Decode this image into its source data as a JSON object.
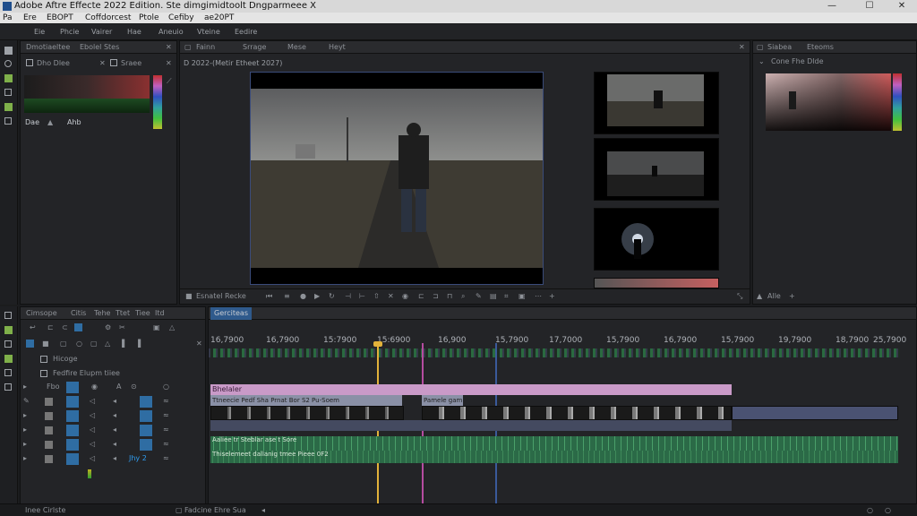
{
  "window": {
    "title": "Adobe Aftre Effecte 2022 Edition. Ste dimgimidtoolt Dngparmeee X",
    "minimize": "—",
    "maximize": "☐",
    "close": "✕"
  },
  "menubar": [
    "Pa",
    "Ere",
    "EBOPT",
    "Coffdorcest",
    "Ptole",
    "Cefiby",
    "ae20PT"
  ],
  "mainbar": {
    "items": [
      "Eie",
      "Phcie",
      "Vairer",
      "Hae",
      "Aneuio",
      "Vteine",
      "Eedire"
    ]
  },
  "left_panel": {
    "tabs": [
      "Dmotiaeltee",
      "Ebolel Stes"
    ],
    "sub_label": "Dho Dlee",
    "sub_label2": "Sraee",
    "footer": [
      "Dae",
      "Ahb"
    ]
  },
  "viewer_panel": {
    "tabs": [
      "Fainn",
      "Srrage",
      "Mese",
      "Heyt"
    ],
    "breadcrumb": "D 2022-(Metir Etheet 2027)",
    "footer_label": "Esnatel Recke"
  },
  "right_panel": {
    "tabs": [
      "Siabea",
      "Eteoms"
    ],
    "sub_label": "Cone Fhe Dlde",
    "footer": "Alle"
  },
  "timeline": {
    "left_tabs": [
      "Cimsope",
      "Citis",
      "Tehe",
      "Ttet",
      "Tiee",
      "Itd"
    ],
    "layer_labels": [
      "Hicoge",
      "Fedfire Elupm tiiee"
    ],
    "sequence_tab": "Gerciteas",
    "ruler": [
      "16,7900",
      "16,7900",
      "15:7900",
      "15:6900",
      "16,900",
      "15,7900",
      "17,7000",
      "15,7900",
      "16,7900",
      "15,7900",
      "19,7900",
      "18,7900",
      "25,7900"
    ],
    "clip_title": "Bhelaler",
    "clip_sub1": "Ttneecie Pedf Sha Prnat Bor S2 Pu-Soem",
    "clip_sub2": "Pamele gam",
    "audio_label1": "Aaliee tr Steblar ase t Sore",
    "audio_label2": "Thiselemeet dallanig tmee Pieee 0F2",
    "footer_left": "Inee Cirlste",
    "footer_mid": "Fadcine Ehre Sua",
    "track_label": "Jhy 2"
  },
  "icons": [
    "search-icon",
    "play-icon",
    "stop-icon",
    "gear-icon",
    "eye-icon",
    "lock-icon",
    "speaker-icon"
  ],
  "colors": {
    "playhead": "#e2b23a",
    "marker": "#b54ca0",
    "clip_pink": "#c99ac8",
    "accent": "#2f6da3"
  }
}
